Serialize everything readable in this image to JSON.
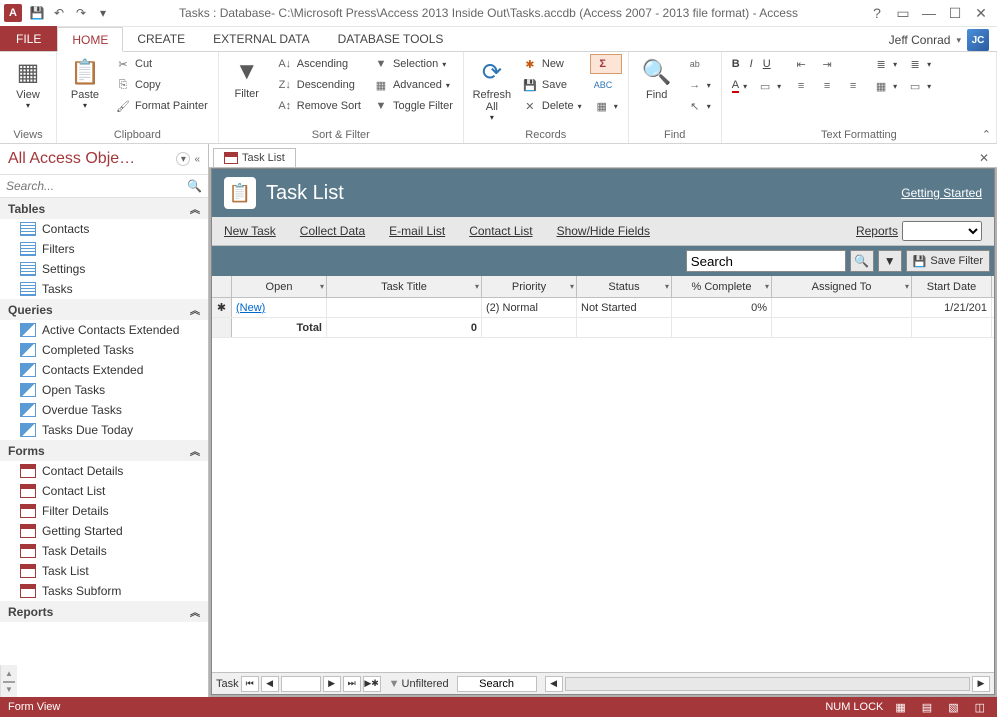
{
  "titlebar": {
    "title": "Tasks : Database- C:\\Microsoft Press\\Access 2013 Inside Out\\Tasks.accdb (Access 2007 - 2013 file format) - Access",
    "app_letter": "A"
  },
  "user": {
    "name": "Jeff Conrad",
    "initials": "JC"
  },
  "tabs": {
    "file": "FILE",
    "home": "HOME",
    "create": "CREATE",
    "external": "EXTERNAL DATA",
    "dbtools": "DATABASE TOOLS"
  },
  "ribbon": {
    "views": {
      "label": "Views",
      "view": "View"
    },
    "clipboard": {
      "label": "Clipboard",
      "paste": "Paste",
      "cut": "Cut",
      "copy": "Copy",
      "fmtpainter": "Format Painter"
    },
    "sortfilter": {
      "label": "Sort & Filter",
      "filter": "Filter",
      "asc": "Ascending",
      "desc": "Descending",
      "remove": "Remove Sort",
      "selection": "Selection",
      "advanced": "Advanced",
      "toggle": "Toggle Filter"
    },
    "records": {
      "label": "Records",
      "refresh": "Refresh\nAll",
      "new": "New",
      "save": "Save",
      "delete": "Delete",
      "totals_icon": "Σ"
    },
    "find": {
      "label": "Find",
      "find": "Find"
    },
    "textfmt": {
      "label": "Text Formatting",
      "bold": "B",
      "italic": "I",
      "underline": "U",
      "font_color": "A"
    }
  },
  "nav": {
    "title": "All Access Obje…",
    "search_placeholder": "Search...",
    "groups": {
      "tables": {
        "label": "Tables",
        "items": [
          "Contacts",
          "Filters",
          "Settings",
          "Tasks"
        ]
      },
      "queries": {
        "label": "Queries",
        "items": [
          "Active Contacts Extended",
          "Completed Tasks",
          "Contacts Extended",
          "Open Tasks",
          "Overdue Tasks",
          "Tasks Due Today"
        ]
      },
      "forms": {
        "label": "Forms",
        "items": [
          "Contact Details",
          "Contact List",
          "Filter Details",
          "Getting Started",
          "Task Details",
          "Task List",
          "Tasks Subform"
        ]
      },
      "reports": {
        "label": "Reports"
      }
    }
  },
  "doc": {
    "tab_label": "Task List"
  },
  "form": {
    "title": "Task List",
    "getting_started": "Getting Started",
    "toolbar": {
      "new_task": "New Task",
      "collect": "Collect Data",
      "email": "E-mail List",
      "contact": "Contact List",
      "showhide": "Show/Hide Fields",
      "reports": "Reports"
    },
    "searchbar": {
      "placeholder": "Search",
      "savefilter": "Save Filter"
    },
    "columns": [
      "Open",
      "Task Title",
      "Priority",
      "Status",
      "% Complete",
      "Assigned To",
      "Start Date"
    ],
    "new_row": {
      "open": "(New)",
      "priority": "(2) Normal",
      "status": "Not Started",
      "complete": "0%",
      "start": "1/21/201"
    },
    "total_row": {
      "label": "Total",
      "title_total": "0"
    }
  },
  "recordnav": {
    "label": "Task",
    "filter": "Unfiltered",
    "search": "Search"
  },
  "statusbar": {
    "mode": "Form View",
    "numlock": "NUM LOCK"
  }
}
